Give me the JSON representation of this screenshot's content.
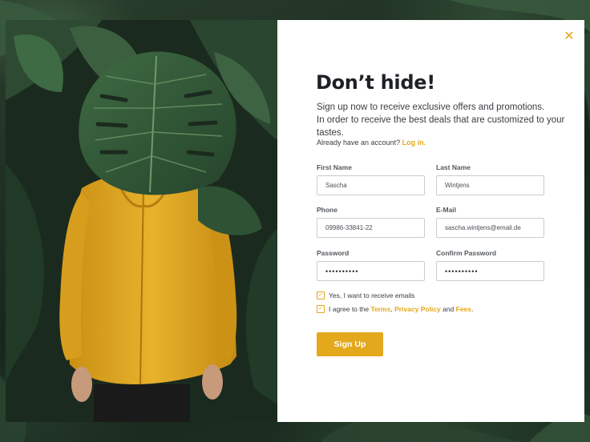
{
  "colors": {
    "accent": "#e3a81c",
    "heading": "#1e2126",
    "jacket": "#e0ab26",
    "foliage": "#2f4a34"
  },
  "icons": {
    "close": "close-icon",
    "check": "checkmark-icon"
  },
  "modal": {
    "close_glyph": "✕",
    "title": "Don’t hide!",
    "subtitle_line1": "Sign up now to receive exclusive offers and promotions.",
    "subtitle_line2": "In order to receive the best deals that are customized to your tastes.",
    "account_prompt": "Already have an account?",
    "login_link": "Log in."
  },
  "form": {
    "first_name": {
      "label": "First Name",
      "value": "Sascha"
    },
    "last_name": {
      "label": "Last Name",
      "value": "Wintjens"
    },
    "phone": {
      "label": "Phone",
      "value": "09986-33841-22"
    },
    "email": {
      "label": "E-Mail",
      "value": "sascha.wintjens@email.de"
    },
    "password": {
      "label": "Password",
      "value": "••••••••••"
    },
    "confirm_password": {
      "label": "Confirm Password",
      "value": "••••••••••"
    }
  },
  "checkboxes": {
    "emails": {
      "checked": true,
      "label": "Yes, I want to receive emails"
    },
    "terms": {
      "checked": true,
      "prefix": "I agree to the ",
      "terms_link": "Terms",
      "comma": ", ",
      "privacy_link": "Privacy Policy",
      "and": " and ",
      "fees_link": "Fees",
      "suffix": "."
    }
  },
  "submit": {
    "label": "Sign Up"
  }
}
